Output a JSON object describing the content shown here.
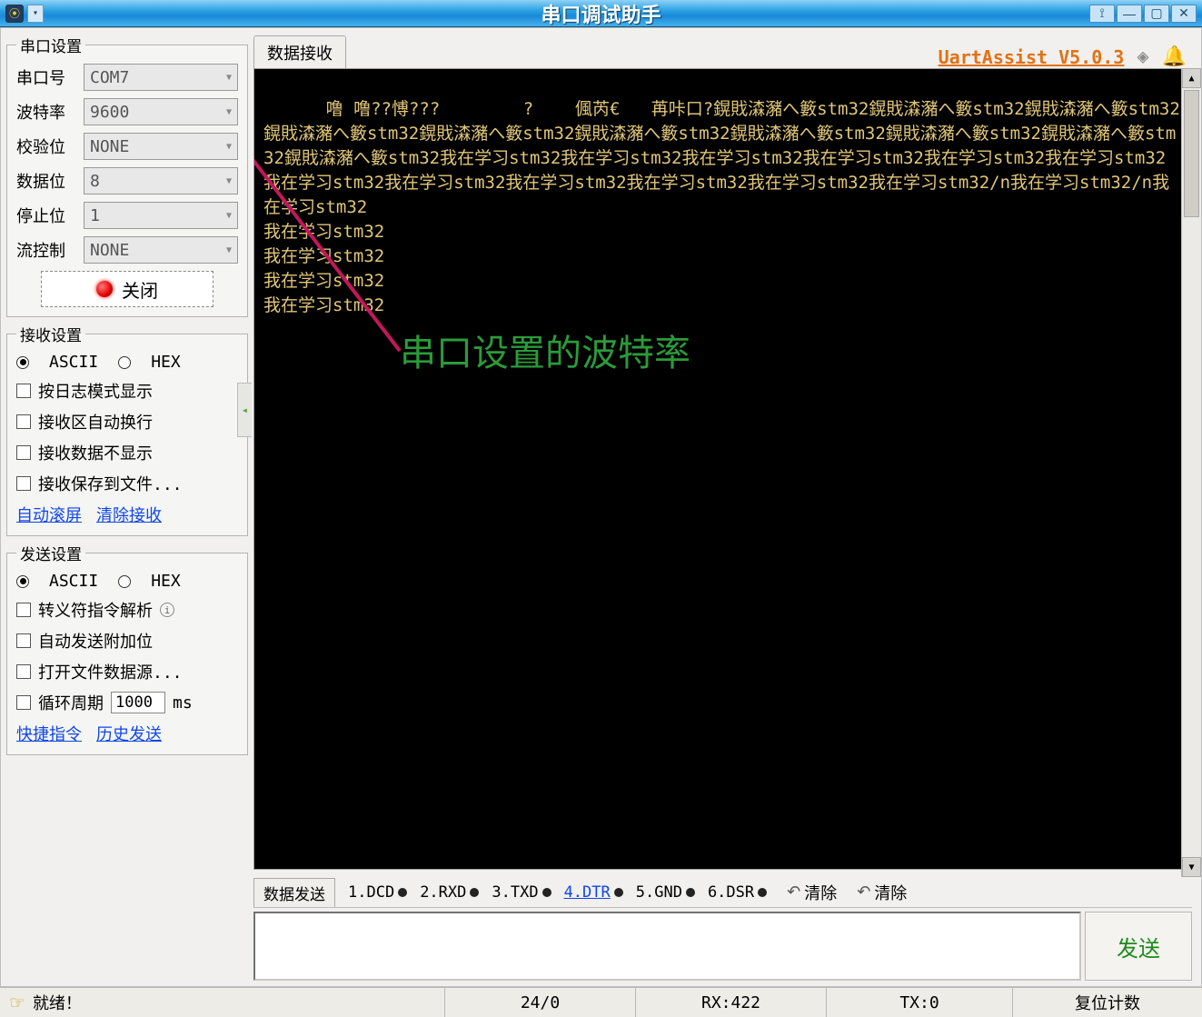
{
  "titlebar": {
    "title": "串口调试助手"
  },
  "brand": {
    "name": "UartAssist V5.0.3"
  },
  "tabs": {
    "recv": "数据接收",
    "send": "数据发送"
  },
  "serial": {
    "legend": "串口设置",
    "fields": {
      "port": {
        "label": "串口号",
        "value": "COM7"
      },
      "baud": {
        "label": "波特率",
        "value": "9600"
      },
      "parity": {
        "label": "校验位",
        "value": "NONE"
      },
      "data": {
        "label": "数据位",
        "value": "8"
      },
      "stop": {
        "label": "停止位",
        "value": "1"
      },
      "flow": {
        "label": "流控制",
        "value": "NONE"
      }
    },
    "connect_btn": "关闭"
  },
  "recv_cfg": {
    "legend": "接收设置",
    "ascii": "ASCII",
    "hex": "HEX",
    "log_mode": "按日志模式显示",
    "auto_wrap": "接收区自动换行",
    "hide_recv": "接收数据不显示",
    "save_file": "接收保存到文件...",
    "auto_scroll": "自动滚屏",
    "clear_recv": "清除接收"
  },
  "send_cfg": {
    "legend": "发送设置",
    "ascii": "ASCII",
    "hex": "HEX",
    "escape": "转义符指令解析",
    "auto_append": "自动发送附加位",
    "open_file": "打开文件数据源...",
    "cycle_label": "循环周期",
    "cycle_value": "1000",
    "cycle_unit": "ms",
    "shortcut": "快捷指令",
    "history": "历史发送"
  },
  "overlay_text": "串口设置的波特率",
  "terminal_text": "噜 噜??愽???        ?    偑芮€   苒咔口?鎤戝潹瀦へ籔stm32鎤戝潹瀦へ籔stm32鎤戝潹瀦へ籔stm32鎤戝潹瀦へ籔stm32鎤戝潹瀦へ籔stm32鎤戝潹瀦へ籔stm32鎤戝潹瀦へ籔stm32鎤戝潹瀦へ籔stm32鎤戝潹瀦へ籔stm32鎤戝潹瀦へ籔stm32我在学习stm32我在学习stm32我在学习stm32我在学习stm32我在学习stm32我在学习stm32我在学习stm32我在学习stm32我在学习stm32我在学习stm32我在学习stm32我在学习stm32/n我在学习stm32/n我在学习stm32\n我在学习stm32\n我在学习stm32\n我在学习stm32\n我在学习stm32",
  "pins": {
    "p1": "1.DCD",
    "p2": "2.RXD",
    "p3": "3.TXD",
    "p4": "4.DTR",
    "p5": "5.GND",
    "p6": "6.DSR"
  },
  "clear_left": "清除",
  "clear_right": "清除",
  "send_btn": "发送",
  "status": {
    "ready": "就绪！",
    "counter": "24/0",
    "rx": "RX:422",
    "tx": "TX:0",
    "reset": "复位计数"
  }
}
